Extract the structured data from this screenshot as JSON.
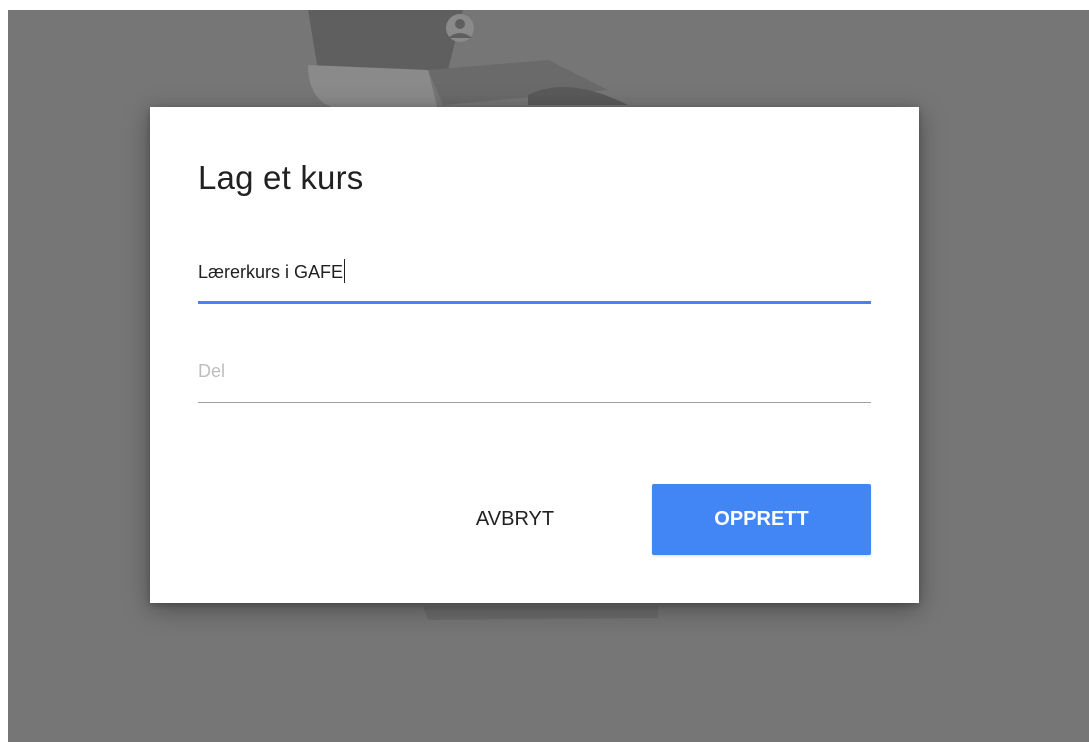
{
  "dialog": {
    "title": "Lag et kurs",
    "course_name": {
      "value": "Lærerkurs i GAFE"
    },
    "section": {
      "placeholder": "Del",
      "value": ""
    },
    "buttons": {
      "cancel_label": "AVBRYT",
      "create_label": "OPPRETT"
    }
  },
  "colors": {
    "overlay": "#767676",
    "accent": "#4285f4",
    "text": "#212121",
    "placeholder": "#bdbdbd"
  }
}
